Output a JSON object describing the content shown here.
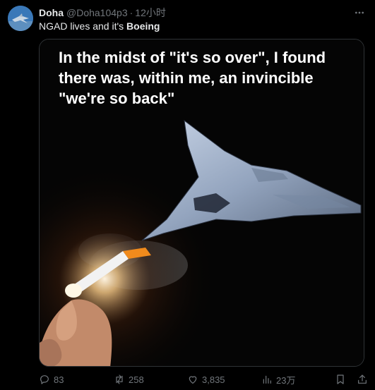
{
  "post": {
    "author_name": "Doha",
    "handle": "@Doha104p3",
    "separator": "·",
    "time": "12小时",
    "text_prefix": "NGAD lives and it's ",
    "text_bold": "Boeing"
  },
  "media": {
    "caption": "In the midst of \"it's so over\", I found there was, within me, an invincible \"we're so back\""
  },
  "actions": {
    "replies": "83",
    "reposts": "258",
    "likes": "3,835",
    "views": "23万"
  },
  "icons": {
    "avatar": "jet-avatar",
    "more": "more-icon",
    "reply": "reply-icon",
    "repost": "repost-icon",
    "like": "like-icon",
    "views": "views-icon",
    "bookmark": "bookmark-icon",
    "share": "share-icon"
  },
  "colors": {
    "background": "#000000",
    "text": "#e7e9ea",
    "muted": "#71767b",
    "border": "#2f3336"
  }
}
